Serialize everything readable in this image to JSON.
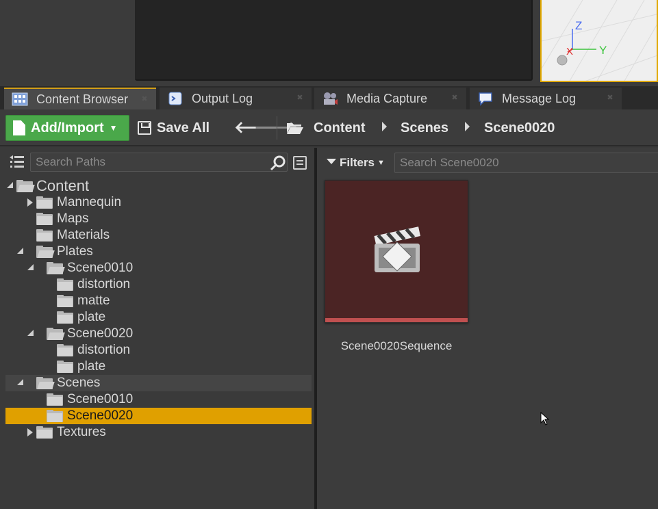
{
  "viewport": {
    "axis_z": "Z",
    "axis_x": "X",
    "axis_y": "Y"
  },
  "tabs": [
    {
      "label": "Content Browser",
      "icon": "content-browser-icon",
      "active": true
    },
    {
      "label": "Output Log",
      "icon": "output-log-icon",
      "active": false
    },
    {
      "label": "Media Capture",
      "icon": "media-capture-icon",
      "active": false
    },
    {
      "label": "Message Log",
      "icon": "message-log-icon",
      "active": false
    }
  ],
  "toolbar": {
    "add_import_label": "Add/Import",
    "save_all_label": "Save All",
    "breadcrumb": [
      "Content",
      "Scenes",
      "Scene0020"
    ]
  },
  "left": {
    "search_placeholder": "Search Paths",
    "tree": [
      {
        "label": "Content",
        "depth": 0,
        "state": "open"
      },
      {
        "label": "Mannequin",
        "depth": 1,
        "state": "closed"
      },
      {
        "label": "Maps",
        "depth": 1,
        "state": "leaf"
      },
      {
        "label": "Materials",
        "depth": 1,
        "state": "leaf"
      },
      {
        "label": "Plates",
        "depth": 1,
        "state": "open"
      },
      {
        "label": "Scene0010",
        "depth": 2,
        "state": "open"
      },
      {
        "label": "distortion",
        "depth": 3,
        "state": "leaf"
      },
      {
        "label": "matte",
        "depth": 3,
        "state": "leaf"
      },
      {
        "label": "plate",
        "depth": 3,
        "state": "leaf"
      },
      {
        "label": "Scene0020",
        "depth": 2,
        "state": "open"
      },
      {
        "label": "distortion",
        "depth": 3,
        "state": "leaf"
      },
      {
        "label": "plate",
        "depth": 3,
        "state": "leaf"
      },
      {
        "label": "Scenes",
        "depth": 1,
        "state": "open"
      },
      {
        "label": "Scene0010",
        "depth": 2,
        "state": "leaf"
      },
      {
        "label": "Scene0020",
        "depth": 2,
        "state": "leaf-selected"
      },
      {
        "label": "Textures",
        "depth": 1,
        "state": "closed"
      }
    ]
  },
  "right": {
    "filters_label": "Filters",
    "search_placeholder": "Search Scene0020",
    "assets": [
      {
        "name": "Scene0020Sequence",
        "type_icon": "level-sequence-icon"
      }
    ]
  },
  "colors": {
    "accent": "#e0a000",
    "add_button": "#4aa84a",
    "asset_tile": "#4b2424",
    "asset_bar": "#c05050"
  }
}
